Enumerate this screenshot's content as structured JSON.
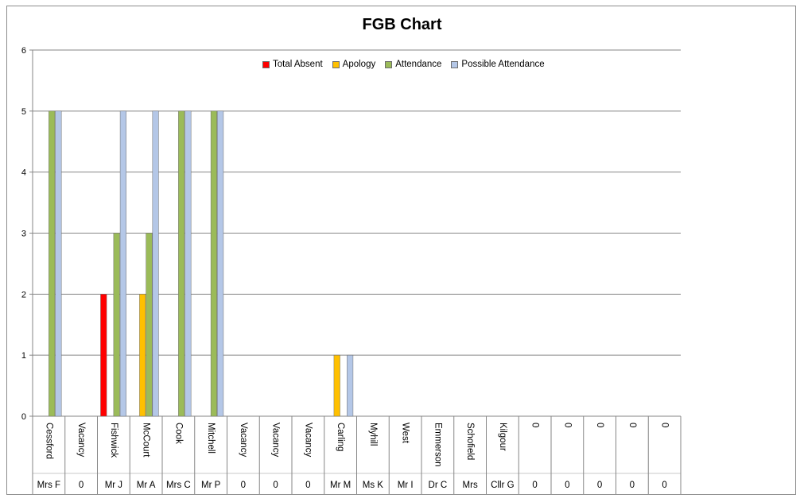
{
  "chart_data": {
    "type": "bar",
    "title": "FGB Chart",
    "ylim": [
      0,
      6
    ],
    "yticks": [
      "0",
      "1",
      "2",
      "3",
      "4",
      "5",
      "6"
    ],
    "grid": true,
    "legend_position": "top",
    "categories_top": [
      "Cessford",
      "Vacancy",
      "Fishwick",
      "McCourt",
      "Cook",
      "Mitchell",
      "Vacancy",
      "Vacancy",
      "Vacancy",
      "Carling",
      "Myhill",
      "West",
      "Emmerson",
      "Schofield",
      "Kilgour",
      "0",
      "0",
      "0",
      "0",
      "0"
    ],
    "categories_bottom": [
      "Mrs F",
      "0",
      "Mr J",
      "Mr A",
      "Mrs C",
      "Mr P",
      "0",
      "0",
      "0",
      "Mr M",
      "Ms K",
      "Mr I",
      "Dr C",
      "Mrs",
      "Cllr G",
      "0",
      "0",
      "0",
      "0",
      "0"
    ],
    "series": [
      {
        "name": "Total Absent",
        "color": "#ff0000",
        "values": [
          0,
          0,
          2,
          0,
          0,
          0,
          0,
          0,
          0,
          0,
          0,
          0,
          0,
          0,
          0,
          0,
          0,
          0,
          0,
          0
        ]
      },
      {
        "name": "Apology",
        "color": "#ffc000",
        "values": [
          0,
          0,
          0,
          2,
          0,
          0,
          0,
          0,
          0,
          1,
          0,
          0,
          0,
          0,
          0,
          0,
          0,
          0,
          0,
          0
        ]
      },
      {
        "name": "Attendance",
        "color": "#9bbb59",
        "values": [
          5,
          0,
          3,
          3,
          5,
          5,
          0,
          0,
          0,
          0,
          0,
          0,
          0,
          0,
          0,
          0,
          0,
          0,
          0,
          0
        ]
      },
      {
        "name": "Possible Attendance",
        "color": "#b4c7e7",
        "values": [
          5,
          0,
          5,
          5,
          5,
          5,
          0,
          0,
          0,
          1,
          0,
          0,
          0,
          0,
          0,
          0,
          0,
          0,
          0,
          0
        ]
      }
    ]
  }
}
